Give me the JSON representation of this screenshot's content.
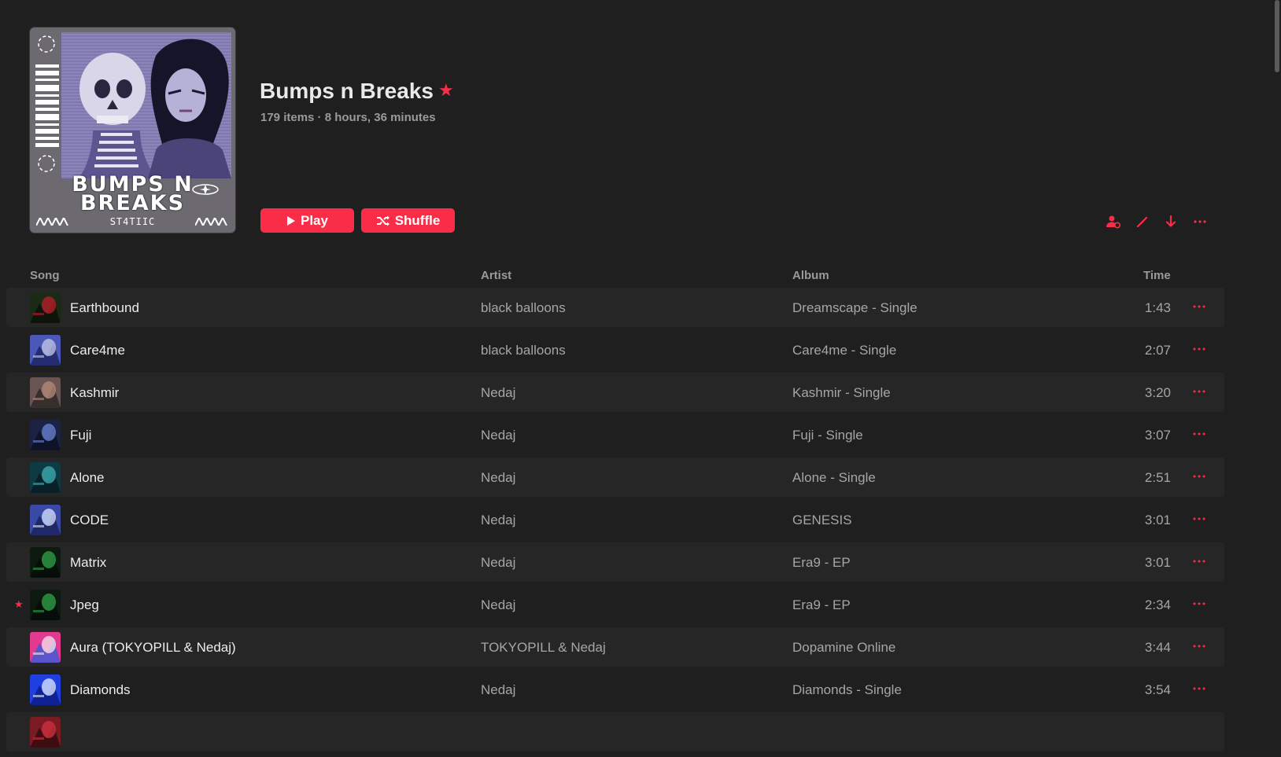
{
  "playlist": {
    "title": "Bumps n Breaks",
    "meta": "179 items · 8 hours, 36 minutes",
    "favorited": true,
    "cover": {
      "title_line1": "BUMPS N",
      "title_line2": "BREAKS",
      "subtitle": "ST4TIIC"
    }
  },
  "actions": {
    "play_label": "Play",
    "shuffle_label": "Shuffle",
    "toolbar_icons": [
      "add-collaborator-icon",
      "edit-icon",
      "download-icon",
      "more-options-icon"
    ]
  },
  "columns": {
    "song": "Song",
    "artist": "Artist",
    "album": "Album",
    "time": "Time"
  },
  "tracks": [
    {
      "title": "Earthbound",
      "artist": "black balloons",
      "album": "Dreamscape - Single",
      "time": "1:43",
      "favorite": false,
      "art": [
        "#1a2a14",
        "#c21d2a",
        "#0a0f0a"
      ]
    },
    {
      "title": "Care4me",
      "artist": "black balloons",
      "album": "Care4me - Single",
      "time": "2:07",
      "favorite": false,
      "art": [
        "#4c58b8",
        "#c6cbe8",
        "#1c2260"
      ]
    },
    {
      "title": "Kashmir",
      "artist": "Nedaj",
      "album": "Kashmir - Single",
      "time": "3:20",
      "favorite": false,
      "art": [
        "#6b5454",
        "#b78c7a",
        "#2a2424"
      ]
    },
    {
      "title": "Fuji",
      "artist": "Nedaj",
      "album": "Fuji - Single",
      "time": "3:07",
      "favorite": false,
      "art": [
        "#1c2244",
        "#6c86d6",
        "#0c1022"
      ]
    },
    {
      "title": "Alone",
      "artist": "Nedaj",
      "album": "Alone - Single",
      "time": "2:51",
      "favorite": false,
      "art": [
        "#0e3a44",
        "#3fb3b6",
        "#0a1a22"
      ]
    },
    {
      "title": "CODE",
      "artist": "Nedaj",
      "album": "GENESIS",
      "time": "3:01",
      "favorite": false,
      "art": [
        "#3a49a6",
        "#d9e4ff",
        "#1a2158"
      ]
    },
    {
      "title": "Matrix",
      "artist": "Nedaj",
      "album": "Era9 - EP",
      "time": "3:01",
      "favorite": false,
      "art": [
        "#0d1a0f",
        "#2fa64a",
        "#060a06"
      ]
    },
    {
      "title": "Jpeg",
      "artist": "Nedaj",
      "album": "Era9 - EP",
      "time": "2:34",
      "favorite": true,
      "art": [
        "#0d1a0f",
        "#2fa64a",
        "#060a06"
      ]
    },
    {
      "title": "Aura (TOKYOPILL & Nedaj)",
      "artist": "TOKYOPILL & Nedaj",
      "album": "Dopamine Online",
      "time": "3:44",
      "favorite": false,
      "art": [
        "#e23a8f",
        "#f5e8f0",
        "#3b5bd8"
      ]
    },
    {
      "title": "Diamonds",
      "artist": "Nedaj",
      "album": "Diamonds - Single",
      "time": "3:54",
      "favorite": false,
      "art": [
        "#1f3fe0",
        "#e6ecff",
        "#0b1a80"
      ]
    },
    {
      "title": "",
      "artist": "",
      "album": "",
      "time": "",
      "favorite": false,
      "art": [
        "#7a1a22",
        "#d23240",
        "#300a0e"
      ]
    }
  ]
}
